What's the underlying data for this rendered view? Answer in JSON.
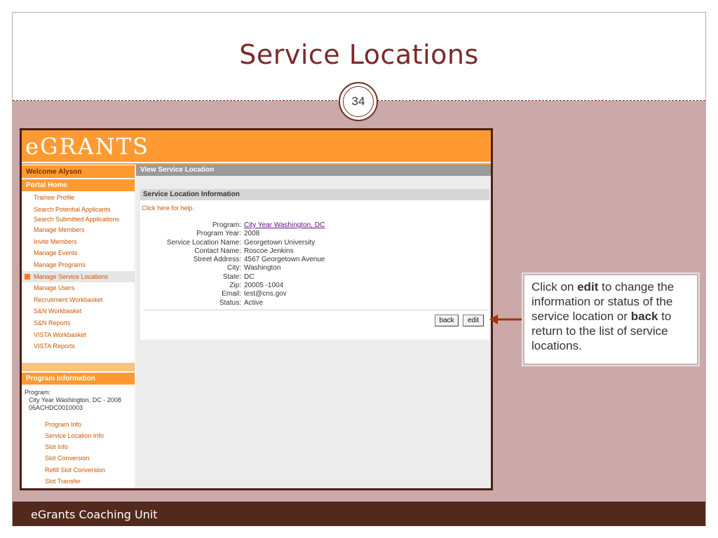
{
  "slide": {
    "title": "Service Locations",
    "number": "34",
    "footer": "eGrants Coaching Unit"
  },
  "app": {
    "logo": "eGRANTS",
    "sidebar": {
      "welcome": "Welcome Alyson",
      "portal_home": "Portal Home",
      "items": [
        {
          "label": "Trainee Profile"
        },
        {
          "label": "Search Potential Applicants"
        },
        {
          "label": "Search Submitted Applications"
        },
        {
          "label": "Manage Members"
        },
        {
          "label": "Invite Members"
        },
        {
          "label": "Manage Events"
        },
        {
          "label": "Manage Programs"
        },
        {
          "label": "Manage Service Locations"
        },
        {
          "label": "Manage Users"
        },
        {
          "label": "Recruitment Workbasket"
        },
        {
          "label": "S&N Workbasket"
        },
        {
          "label": "S&N Reports"
        },
        {
          "label": "VISTA Workbasket"
        },
        {
          "label": "VISTA Reports"
        }
      ],
      "program_info_title": "Program Information",
      "program_label": "Program:",
      "program_name": "City Year Washington, DC - 2008",
      "program_code": "06ACHDC0010003",
      "program_links": [
        {
          "label": "Program Info"
        },
        {
          "label": "Service Location Info"
        },
        {
          "label": "Slot Info"
        },
        {
          "label": "Slot Conversion"
        },
        {
          "label": "Refill Slot Conversion"
        },
        {
          "label": "Slot Transfer"
        }
      ]
    },
    "main": {
      "view_title": "View Service Location",
      "panel_title": "Service Location Information",
      "help_link": "Click here for help.",
      "fields": [
        {
          "label": "Program:",
          "value": "City Year Washington, DC"
        },
        {
          "label": "Program Year:",
          "value": "2008"
        },
        {
          "label": "Service Location Name:",
          "value": "Georgetown University"
        },
        {
          "label": "Contact Name:",
          "value": "Roscoe Jenkins"
        },
        {
          "label": "Street Address:",
          "value": "4567 Georgetown Avenue"
        },
        {
          "label": "City:",
          "value": "Washington"
        },
        {
          "label": "State:",
          "value": "DC"
        },
        {
          "label": "Zip:",
          "value": "20005 -1004"
        },
        {
          "label": "Email:",
          "value": "test@cns.gov"
        },
        {
          "label": "Status:",
          "value": "Active"
        }
      ],
      "back_label": "back",
      "edit_label": "edit"
    }
  },
  "callout": {
    "t1": "Click on ",
    "edit": "edit",
    "t2": " to change the information or status of the service location or ",
    "back": "back",
    "t3": " to return to the list of service locations."
  },
  "colors": {
    "title": "#7b2a2a",
    "footer": "#522a1c",
    "content_bg": "#cca9a9",
    "egrants_orange": "#ff9a33",
    "arrow": "#a3320f"
  }
}
